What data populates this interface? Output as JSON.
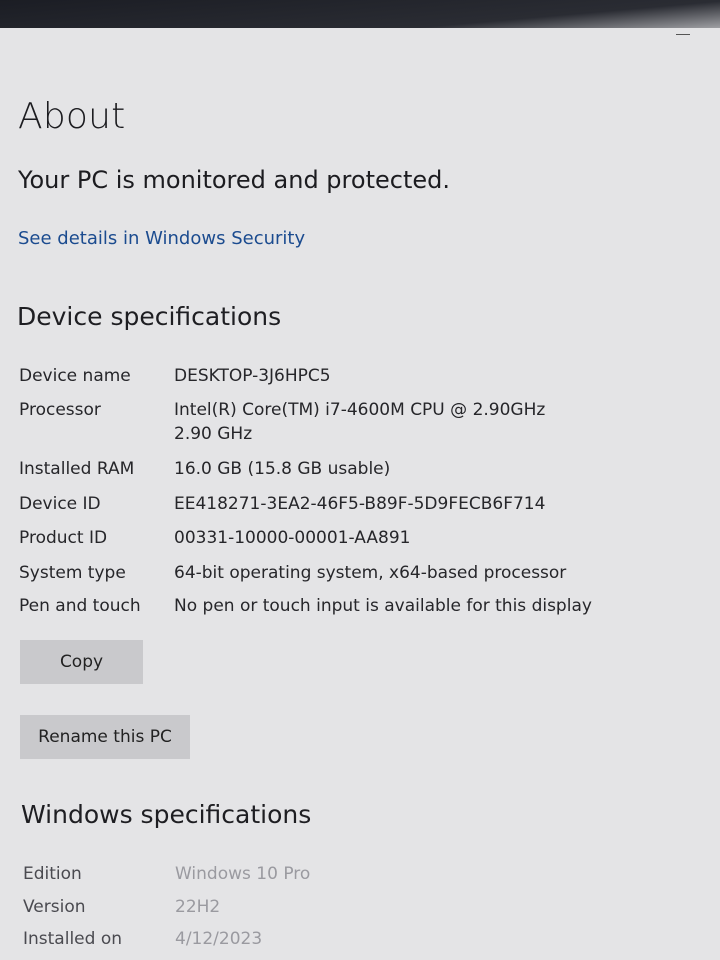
{
  "about": {
    "title": "About",
    "protection_message": "Your PC is monitored and protected.",
    "security_link": "See details in Windows Security"
  },
  "device_specs": {
    "heading": "Device specifications",
    "rows": [
      {
        "label": "Device name",
        "value": "DESKTOP-3J6HPC5"
      },
      {
        "label": "Processor",
        "value": "Intel(R) Core(TM) i7-4600M CPU @ 2.90GHz   2.90 GHz"
      },
      {
        "label": "Installed RAM",
        "value": "16.0 GB (15.8 GB usable)"
      },
      {
        "label": "Device ID",
        "value": "EE418271-3EA2-46F5-B89F-5D9FECB6F714"
      },
      {
        "label": "Product ID",
        "value": "00331-10000-00001-AA891"
      },
      {
        "label": "System type",
        "value": "64-bit operating system, x64-based processor"
      },
      {
        "label": "Pen and touch",
        "value": "No pen or touch input is available for this display"
      }
    ],
    "copy_label": "Copy",
    "rename_label": "Rename this PC"
  },
  "windows_specs": {
    "heading": "Windows specifications",
    "rows": [
      {
        "label": "Edition",
        "value": "Windows 10 Pro"
      },
      {
        "label": "Version",
        "value": "22H2"
      },
      {
        "label": "Installed on",
        "value": "4/12/2023"
      }
    ]
  }
}
